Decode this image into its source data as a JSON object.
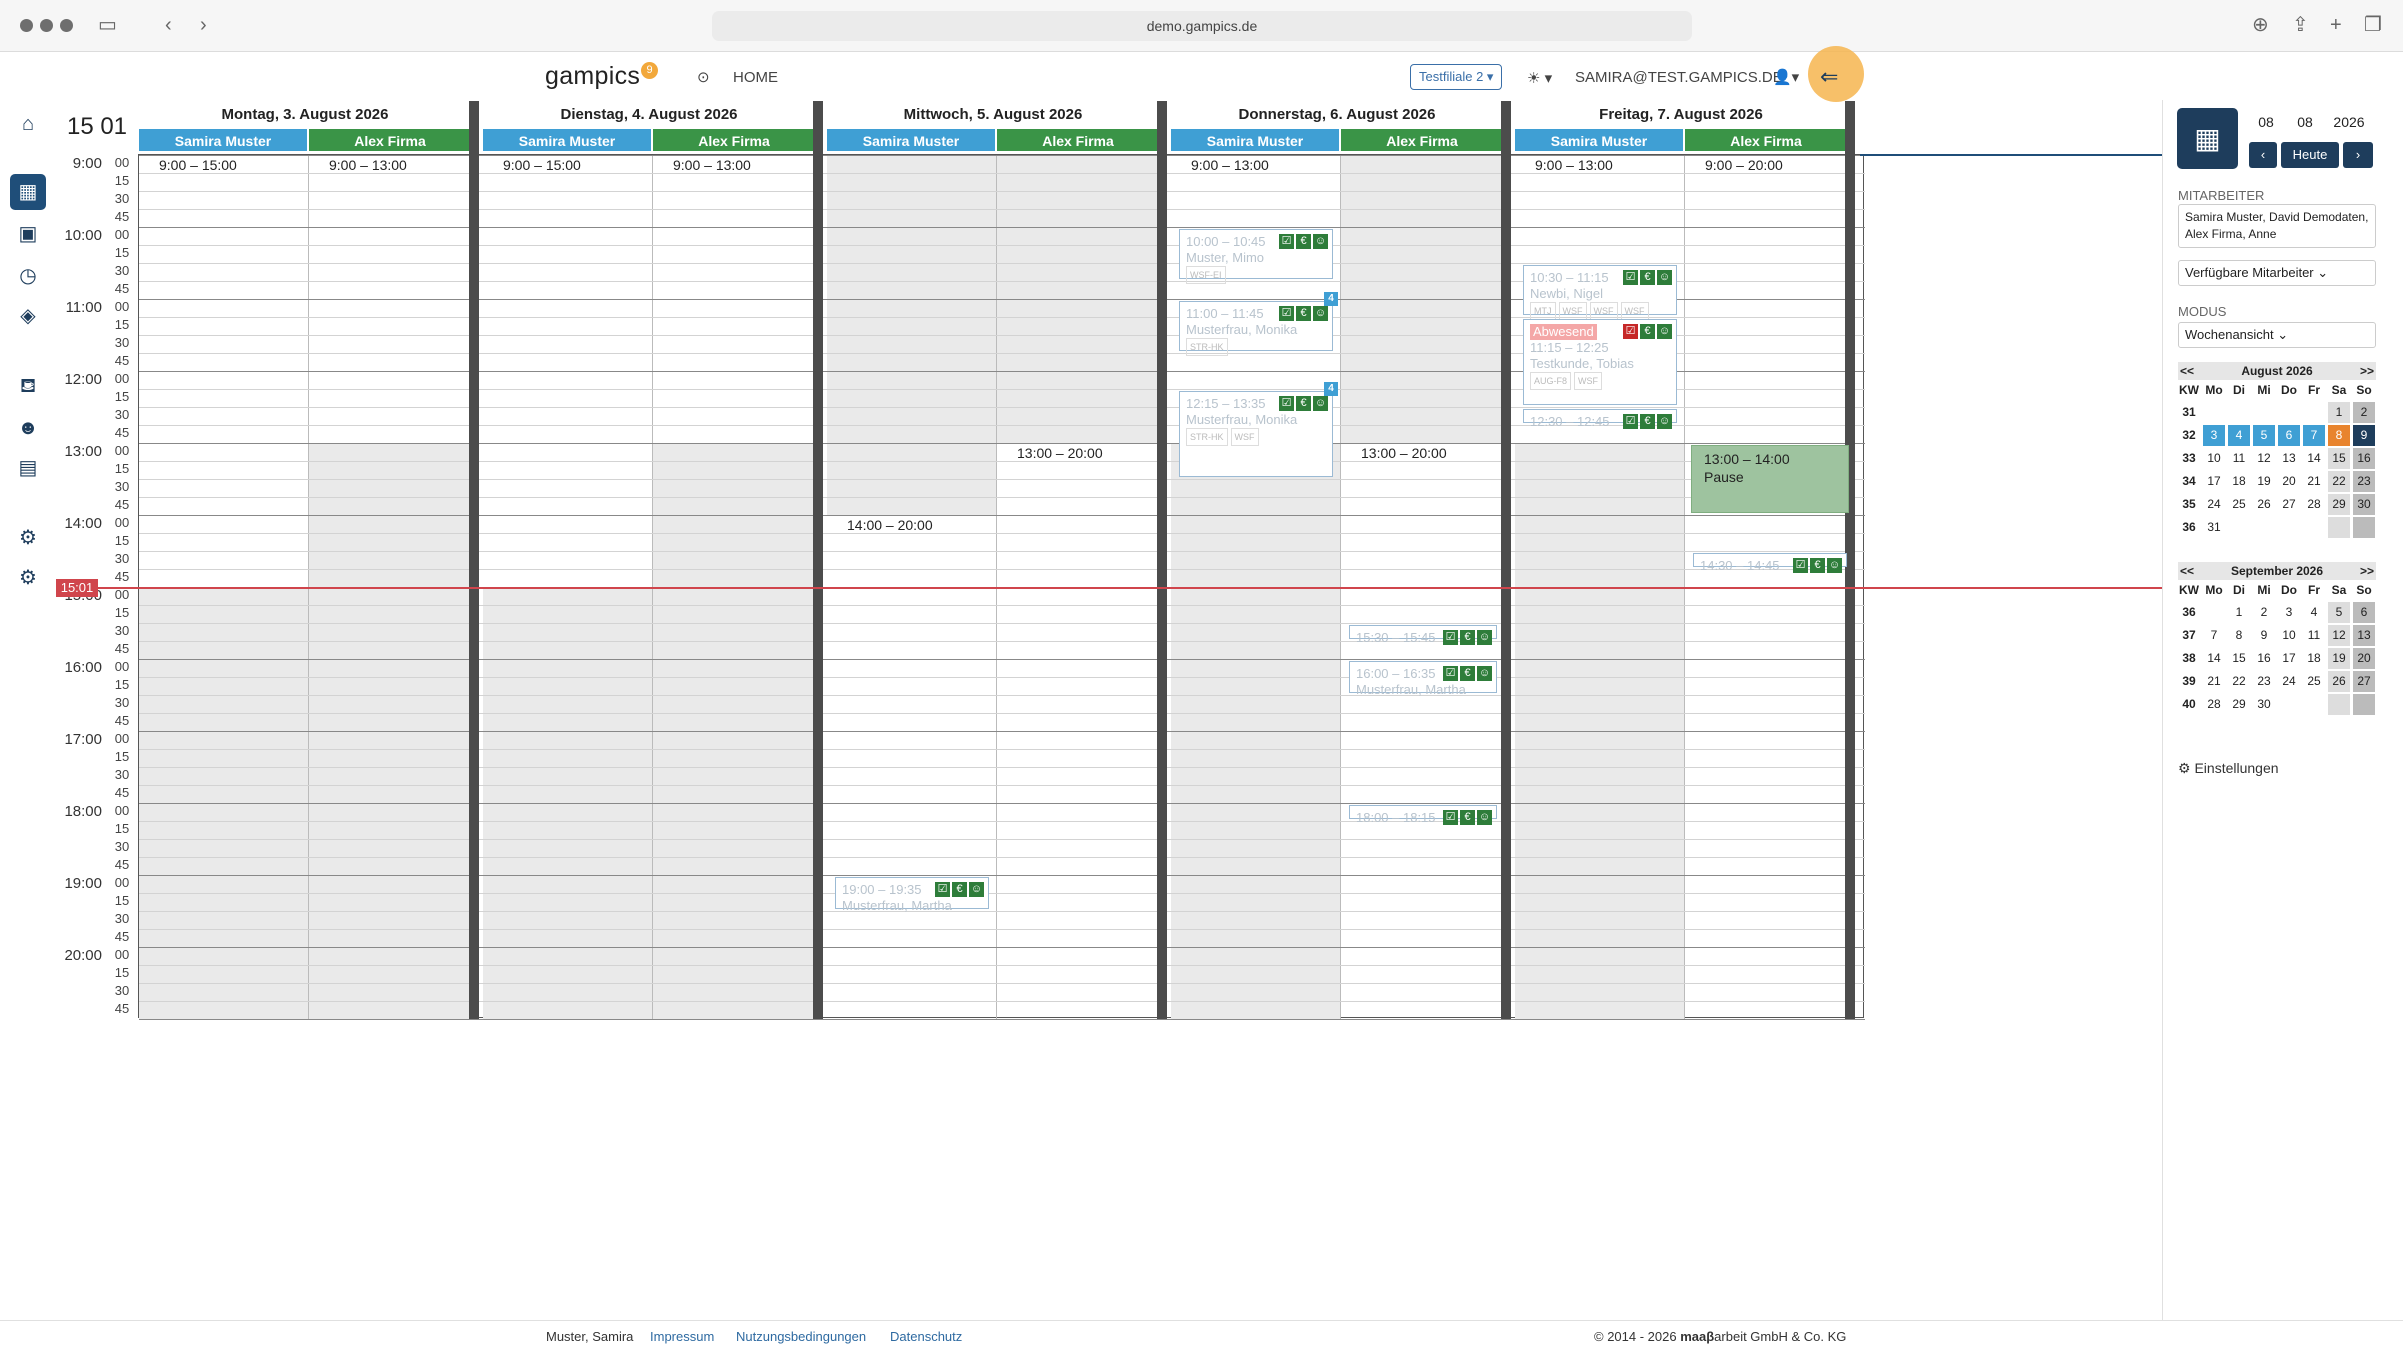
{
  "browser": {
    "url": "demo.gampics.de"
  },
  "topnav": {
    "logo": "gampics",
    "logo_badge": "9",
    "home_label": "HOME",
    "filiale_button": "Testfiliale 2 ▾",
    "theme_toggle": "☀ ▾",
    "user_email": "SAMIRA@TEST.GAMPICS.DE"
  },
  "calendar": {
    "current_time": "15 01",
    "now_label": "15:01",
    "days": [
      {
        "label": "Montag, 3. August 2026",
        "employees": [
          "Samira Muster",
          "Alex Firma"
        ],
        "shifts": [
          "9:00 – 15:00",
          "9:00 – 13:00"
        ]
      },
      {
        "label": "Dienstag, 4. August 2026",
        "employees": [
          "Samira Muster",
          "Alex Firma"
        ],
        "shifts": [
          "9:00 – 15:00",
          "9:00 – 13:00"
        ]
      },
      {
        "label": "Mittwoch, 5. August 2026",
        "employees": [
          "Samira Muster",
          "Alex Firma"
        ],
        "shifts": [
          "14:00 – 20:00",
          "13:00 – 20:00"
        ]
      },
      {
        "label": "Donnerstag, 6. August 2026",
        "employees": [
          "Samira Muster",
          "Alex Firma"
        ],
        "shifts": [
          "9:00 – 13:00",
          "13:00 – 20:00"
        ]
      },
      {
        "label": "Freitag, 7. August 2026",
        "employees": [
          "Samira Muster",
          "Alex Firma"
        ],
        "shifts": [
          "9:00 – 13:00",
          "9:00 – 20:00"
        ]
      }
    ],
    "hours": [
      "9:00",
      "10:00",
      "11:00",
      "12:00",
      "13:00",
      "14:00",
      "15:00",
      "16:00",
      "17:00",
      "18:00",
      "19:00",
      "20:00"
    ],
    "minutes": [
      "00",
      "15",
      "30",
      "45"
    ],
    "appointments": {
      "do1_time": "10:00 – 10:45",
      "do1_name": "Muster, Mimo",
      "do1_tag": "WSF-EI",
      "do2_time": "11:00 – 11:45",
      "do2_name": "Musterfrau, Monika",
      "do2_tag": "STR-HK",
      "do3_time": "12:15 – 13:35",
      "do3_name": "Musterfrau, Monika",
      "do3_tag1": "STR-HK",
      "do3_tag2": "WSF",
      "fr1_time": "10:30 – 11:15",
      "fr1_name": "Newbi, Nigel",
      "fr1_tags": [
        "MTJ",
        "WSF",
        "WSF",
        "WSF"
      ],
      "fr2_status": "Abwesend",
      "fr2_time": "11:15 – 12:25",
      "fr2_name": "Testkunde, Tobias",
      "fr2_tag1": "AUG-F8",
      "fr2_tag2": "WSF",
      "fr3_time": "12:30 – 12:45",
      "fr_pause_time": "13:00 – 14:00",
      "fr_pause_label": "Pause",
      "fr4_time": "14:30 – 14:45",
      "do4_time": "15:30 – 15:45",
      "do5_time": "16:00 – 16:35",
      "do5_name": "Musterfrau, Martha",
      "do6_time": "18:00 – 18:15",
      "mi1_time": "19:00 – 19:35",
      "mi1_name": "Musterfrau, Martha",
      "badge_count": "4"
    }
  },
  "sidebar": {
    "day": "08",
    "month": "08",
    "year": "2026",
    "today_button": "Heute",
    "mitarbeiter_label": "MITARBEITER",
    "mitarbeiter_value": "Samira Muster, David Demodaten, Alex Firma, Anne",
    "verfuegbar_label": "Verfügbare Mitarbeiter",
    "modus_label": "MODUS",
    "modus_value": "Wochenansicht",
    "settings_label": "Einstellungen",
    "prev": "<<",
    "next": ">>",
    "weekday_headers": [
      "KW",
      "Mo",
      "Di",
      "Mi",
      "Do",
      "Fr",
      "Sa",
      "So"
    ],
    "aug": {
      "title": "August 2026",
      "rows": [
        [
          "31",
          "",
          "",
          "",
          "",
          "",
          "1",
          "2"
        ],
        [
          "32",
          "3",
          "4",
          "5",
          "6",
          "7",
          "8",
          "9"
        ],
        [
          "33",
          "10",
          "11",
          "12",
          "13",
          "14",
          "15",
          "16"
        ],
        [
          "34",
          "17",
          "18",
          "19",
          "20",
          "21",
          "22",
          "23"
        ],
        [
          "35",
          "24",
          "25",
          "26",
          "27",
          "28",
          "29",
          "30"
        ],
        [
          "36",
          "31",
          "",
          "",
          "",
          "",
          "",
          ""
        ]
      ]
    },
    "sep": {
      "title": "September 2026",
      "rows": [
        [
          "36",
          "",
          "1",
          "2",
          "3",
          "4",
          "5",
          "6"
        ],
        [
          "37",
          "7",
          "8",
          "9",
          "10",
          "11",
          "12",
          "13"
        ],
        [
          "38",
          "14",
          "15",
          "16",
          "17",
          "18",
          "19",
          "20"
        ],
        [
          "39",
          "21",
          "22",
          "23",
          "24",
          "25",
          "26",
          "27"
        ],
        [
          "40",
          "28",
          "29",
          "30",
          "",
          "",
          "",
          ""
        ]
      ]
    }
  },
  "footer": {
    "user": "Muster, Samira",
    "impressum": "Impressum",
    "nutzung": "Nutzungsbedingungen",
    "datenschutz": "Datenschutz",
    "copyright_pre": "© 2014 - 2026 ",
    "copyright_brand": "maaβ",
    "copyright_post": "arbeit GmbH & Co. KG"
  }
}
